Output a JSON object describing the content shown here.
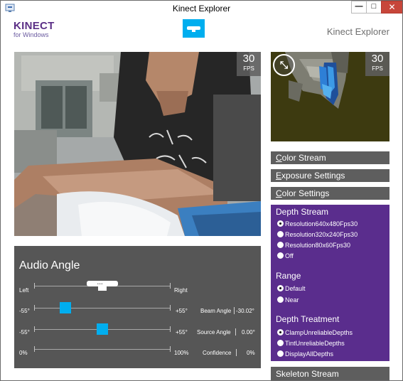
{
  "window": {
    "title": "Kinect Explorer",
    "min_glyph": "—",
    "max_glyph": "□",
    "close_glyph": "✕"
  },
  "header": {
    "logo_main": "KINECT",
    "logo_sub": "for Windows",
    "title": "Kinect Explorer"
  },
  "color_view": {
    "fps_value": "30",
    "fps_unit": "FPS"
  },
  "depth_view": {
    "fps_value": "30",
    "fps_unit": "FPS",
    "toggle_glyph": "⤡"
  },
  "panels": {
    "color_stream": "Color Stream",
    "exposure_settings": "Exposure Settings",
    "color_settings": "Color Settings",
    "depth_stream": "Depth Stream",
    "skeleton_stream": "Skeleton Stream"
  },
  "depth_stream": {
    "resolutions": [
      {
        "label": "Resolution640x480Fps30",
        "selected": true
      },
      {
        "label": "Resolution320x240Fps30",
        "selected": false
      },
      {
        "label": "Resolution80x60Fps30",
        "selected": false
      },
      {
        "label": "Off",
        "selected": false
      }
    ],
    "range_title": "Range",
    "range_options": [
      {
        "label": "Default",
        "selected": true
      },
      {
        "label": "Near",
        "selected": false
      }
    ],
    "treatment_title": "Depth Treatment",
    "treatment_options": [
      {
        "label": "ClampUnreliableDepths",
        "selected": true
      },
      {
        "label": "TintUnreliableDepths",
        "selected": false
      },
      {
        "label": "DisplayAllDepths",
        "selected": false
      }
    ]
  },
  "audio": {
    "title": "Audio Angle",
    "left_label": "Left",
    "right_label": "Right",
    "beam": {
      "min": "-55°",
      "max": "+55°",
      "label": "Beam Angle",
      "value": "-30.02°",
      "fraction": 0.227
    },
    "source": {
      "min": "-55°",
      "max": "+55°",
      "label": "Source Angle",
      "value": "0.00°",
      "fraction": 0.5
    },
    "confidence": {
      "min": "0%",
      "max": "100%",
      "label": "Confidence",
      "value": "0%",
      "fraction": 0.0
    }
  },
  "colors": {
    "accent": "#00aeef",
    "purple": "#5a2d8d",
    "panel_gray": "#5e5e5e",
    "audio_bg": "#565656",
    "close": "#c7463a"
  }
}
